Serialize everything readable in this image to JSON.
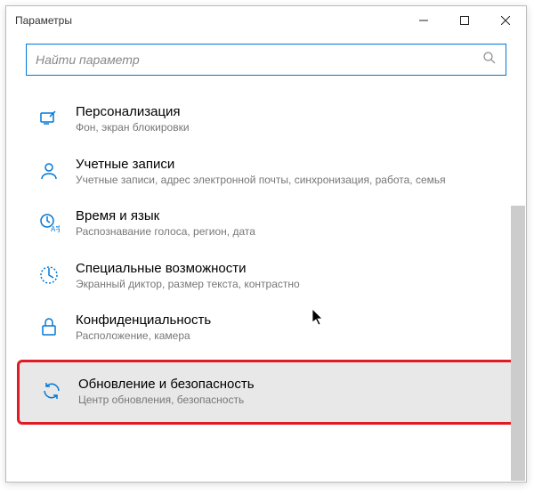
{
  "titlebar": {
    "title": "Параметры"
  },
  "search": {
    "placeholder": "Найти параметр"
  },
  "items": [
    {
      "title": "Персонализация",
      "desc": "Фон, экран блокировки"
    },
    {
      "title": "Учетные записи",
      "desc": "Учетные записи, адрес электронной почты, синхронизация, работа, семья"
    },
    {
      "title": "Время и язык",
      "desc": "Распознавание голоса, регион, дата"
    },
    {
      "title": "Специальные возможности",
      "desc": "Экранный диктор, размер текста, контрастно"
    },
    {
      "title": "Конфиденциальность",
      "desc": "Расположение, камера"
    },
    {
      "title": "Обновление и безопасность",
      "desc": "Центр обновления, безопасность"
    }
  ]
}
